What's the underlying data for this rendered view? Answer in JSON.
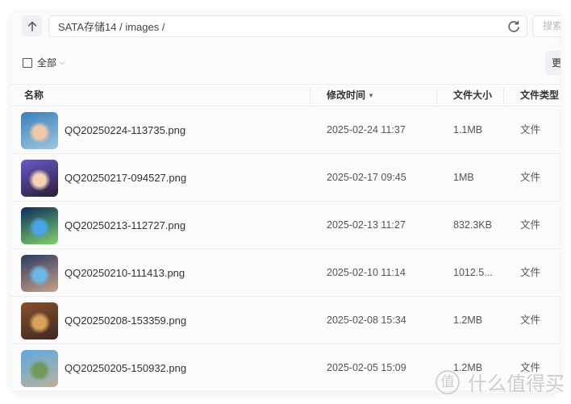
{
  "toolbar": {
    "up_icon": "arrow-up-icon",
    "path": "SATA存储14 / images /",
    "refresh_icon": "refresh-icon",
    "search_placeholder": "搜索",
    "select_all_label": "全部",
    "more_label": "更多"
  },
  "table": {
    "columns": {
      "name": "名称",
      "modified": "修改时间",
      "size": "文件大小",
      "type": "文件类型"
    },
    "sort_indicator": "▼",
    "rows": [
      {
        "name": "QQ20250224-113735.png",
        "modified": "2025-02-24 11:37",
        "size": "1.1MB",
        "type": "文件",
        "thumb_colors": [
          "#3a7fb8",
          "#f0c9a8",
          "#9fc6e0"
        ]
      },
      {
        "name": "QQ20250217-094527.png",
        "modified": "2025-02-17 09:45",
        "size": "1MB",
        "type": "文件",
        "thumb_colors": [
          "#6a58c9",
          "#f2d3b8",
          "#2a1e3a"
        ]
      },
      {
        "name": "QQ20250213-112727.png",
        "modified": "2025-02-13 11:27",
        "size": "832.3KB",
        "type": "文件",
        "thumb_colors": [
          "#0d2a5c",
          "#4aa3e8",
          "#7fd36b"
        ]
      },
      {
        "name": "QQ20250210-111413.png",
        "modified": "2025-02-10 11:14",
        "size": "1012.5...",
        "type": "文件",
        "thumb_colors": [
          "#2b3b5e",
          "#6db6e6",
          "#c9a08a"
        ]
      },
      {
        "name": "QQ20250208-153359.png",
        "modified": "2025-02-08 15:34",
        "size": "1.2MB",
        "type": "文件",
        "thumb_colors": [
          "#8a4e2c",
          "#d6a35c",
          "#3b2a22"
        ]
      },
      {
        "name": "QQ20250205-150932.png",
        "modified": "2025-02-05 15:09",
        "size": "1.2MB",
        "type": "文件",
        "thumb_colors": [
          "#5fa8e0",
          "#6d9a5a",
          "#b9b29a"
        ]
      }
    ]
  },
  "watermark": {
    "badge": "值",
    "text": "什么值得买"
  }
}
